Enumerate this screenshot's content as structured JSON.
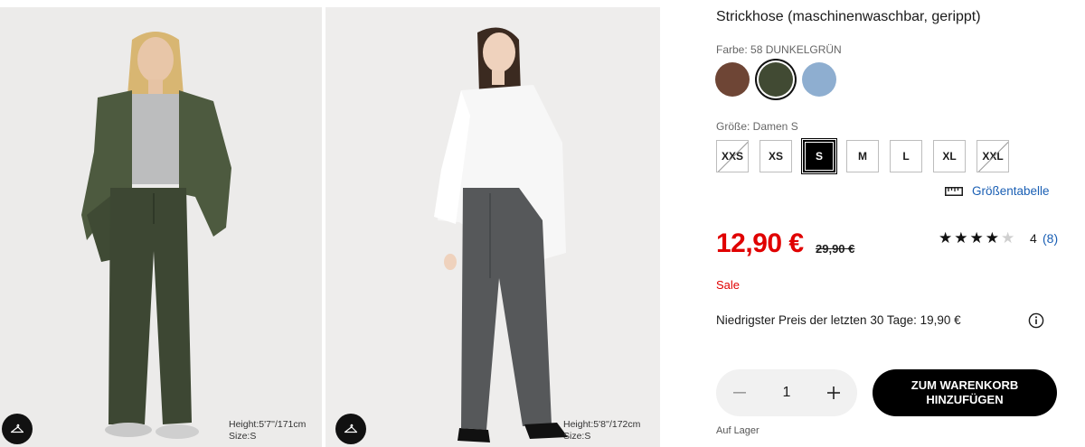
{
  "product": {
    "title": "Strickhose (maschinenwaschbar, gerippt)",
    "color_label": "Farbe: 58 DUNKELGRÜN",
    "colors": [
      {
        "name": "brown",
        "hex": "#6e4535"
      },
      {
        "name": "dark-green",
        "hex": "#414a33",
        "selected": true
      },
      {
        "name": "light-blue",
        "hex": "#8eaed0"
      }
    ],
    "size_label": "Größe: Damen S",
    "sizes": [
      {
        "label": "XXS",
        "state": "unavailable"
      },
      {
        "label": "XS",
        "state": "available"
      },
      {
        "label": "S",
        "state": "selected"
      },
      {
        "label": "M",
        "state": "available"
      },
      {
        "label": "L",
        "state": "available"
      },
      {
        "label": "XL",
        "state": "available"
      },
      {
        "label": "XXL",
        "state": "unavailable"
      }
    ],
    "size_chart_label": "Größentabelle",
    "price": "12,90 €",
    "old_price": "29,90 €",
    "rating_value": "4",
    "rating_stars": 4,
    "rating_count": "(8)",
    "sale_label": "Sale",
    "lowest_price_text": "Niedrigster Preis der letzten 30 Tage: 19,90 €",
    "quantity": "1",
    "add_to_cart_label": "ZUM WARENKORB HINZUFÜGEN",
    "stock_label": "Auf Lager",
    "accent_red": "#e00000",
    "link_blue": "#1a5fb4"
  },
  "images": [
    {
      "height_label": "Height:5'7''/171cm",
      "size_label": "Size:S",
      "icon": "hanger-icon"
    },
    {
      "height_label": "Height:5'8''/172cm",
      "size_label": "Size:S",
      "icon": "hanger-icon"
    }
  ]
}
